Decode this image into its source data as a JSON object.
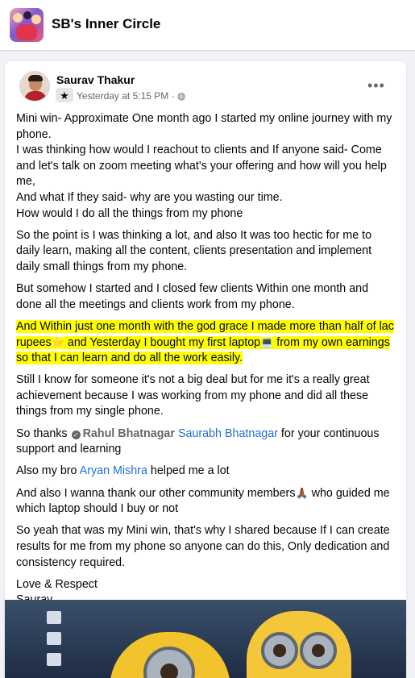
{
  "header": {
    "group_name": "SB's Inner Circle"
  },
  "post": {
    "author": "Saurav Thakur",
    "badge_icon": "star-icon",
    "time": "Yesterday at 5:15 PM",
    "separator": "·",
    "privacy_icon": "globe-icon",
    "more_label": "•••",
    "paragraphs": {
      "p1": [
        "Mini win- Approximate One month ago I started my online journey with my phone.",
        "I was thinking how would I reachout to clients and If anyone said- Come and let's talk on zoom meeting what's your offering and how will you help me,",
        "And what If they said- why are you wasting our time.",
        "How would I do all the things from my phone"
      ],
      "p2": "So the point is I was thinking a lot, and also It was too hectic for me to daily learn, making all the content, clients presentation  and implement daily small things from my phone.",
      "p3": "But somehow I started and I closed few clients Within one month and done all the meetings and clients work from my phone.",
      "p4": {
        "part1": "And Within just one month with the god grace I made more than half of lac rupees",
        "emoji1": "⭐",
        "part2": " and Yesterday I bought my first laptop",
        "emoji2": "💻",
        "part3": " from my own earnings so that I can learn and do all the work easily."
      },
      "p5": "Still I know for someone it's not a big deal but for me it's a really great achievement because I was working from my phone and did all these things from my single phone.",
      "p6": {
        "prefix": "So thanks ",
        "verified_mark": "✓",
        "mention1": "Rahul Bhatnagar",
        "mention2": "Saurabh Bhatnagar",
        "suffix": "  for your continuous support and learning"
      },
      "p7": {
        "prefix": "Also my bro ",
        "mention": "Aryan Mishra",
        "suffix": "  helped me a lot"
      },
      "p8": {
        "part1": "And also I wanna thank our other community members",
        "emoji": "🙏🏾",
        "part2": " who guided me which laptop should I buy or not"
      },
      "p9": "So yeah that was my Mini win, that's why I shared because If I can create results for me from my phone so anyone can do this, Only dedication and consistency required.",
      "p10": [
        "Love & Respect",
        "Saurav"
      ]
    }
  },
  "colors": {
    "background": "#f0f2f5",
    "card": "#ffffff",
    "text": "#050505",
    "meta": "#65676b",
    "mention": "#216fdb",
    "highlight": "#ffff00"
  }
}
